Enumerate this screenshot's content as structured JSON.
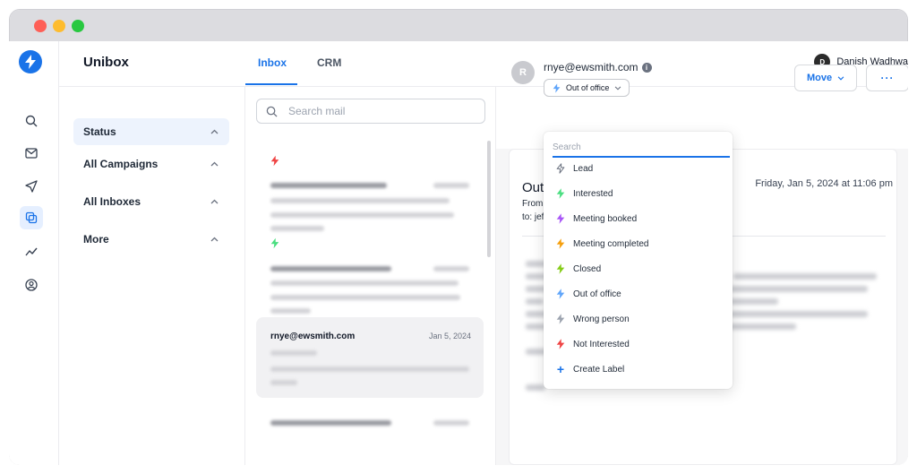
{
  "app": {
    "name": "Unibox"
  },
  "tabs": [
    {
      "label": "Inbox",
      "active": true
    },
    {
      "label": "CRM",
      "active": false
    }
  ],
  "user": {
    "initial": "D",
    "name": "Danish Wadhwa"
  },
  "filters": [
    {
      "label": "Status",
      "active": true
    },
    {
      "label": "All Campaigns",
      "active": false
    },
    {
      "label": "All Inboxes",
      "active": false
    },
    {
      "label": "More",
      "active": false
    }
  ],
  "search": {
    "placeholder": "Search mail"
  },
  "mails": [
    {
      "from": "",
      "date": "",
      "bolt_color": "#ef4444",
      "selected": false
    },
    {
      "from": "",
      "date": "",
      "bolt_color": "#4ade80",
      "selected": false
    },
    {
      "from": "rnye@ewsmith.com",
      "date": "Jan 5, 2024",
      "bolt_color": "",
      "selected": true
    },
    {
      "from": "",
      "date": "",
      "bolt_color": "",
      "selected": false
    }
  ],
  "detail": {
    "avatar_initial": "R",
    "sender_email": "rnye@ewsmith.com",
    "status_label": "Out of office",
    "move_label": "Move",
    "more_label": "···",
    "subject": "Out",
    "from_label": "From",
    "to_label": "to: jef",
    "date": "Friday, Jan 5, 2024 at 11:06 pm"
  },
  "dropdown": {
    "search_placeholder": "Search",
    "items": [
      {
        "label": "Lead",
        "color": "#9ca3af",
        "outline": true
      },
      {
        "label": "Interested",
        "color": "#4ade80"
      },
      {
        "label": "Meeting booked",
        "color": "#a855f7"
      },
      {
        "label": "Meeting completed",
        "color": "#f59e0b"
      },
      {
        "label": "Closed",
        "color": "#84cc16"
      },
      {
        "label": "Out of office",
        "color": "#60a5fa"
      },
      {
        "label": "Wrong person",
        "color": "#9ca3af"
      },
      {
        "label": "Not Interested",
        "color": "#ef4444"
      }
    ],
    "create_label": "Create Label"
  },
  "colors": {
    "accent": "#1a73e8"
  }
}
